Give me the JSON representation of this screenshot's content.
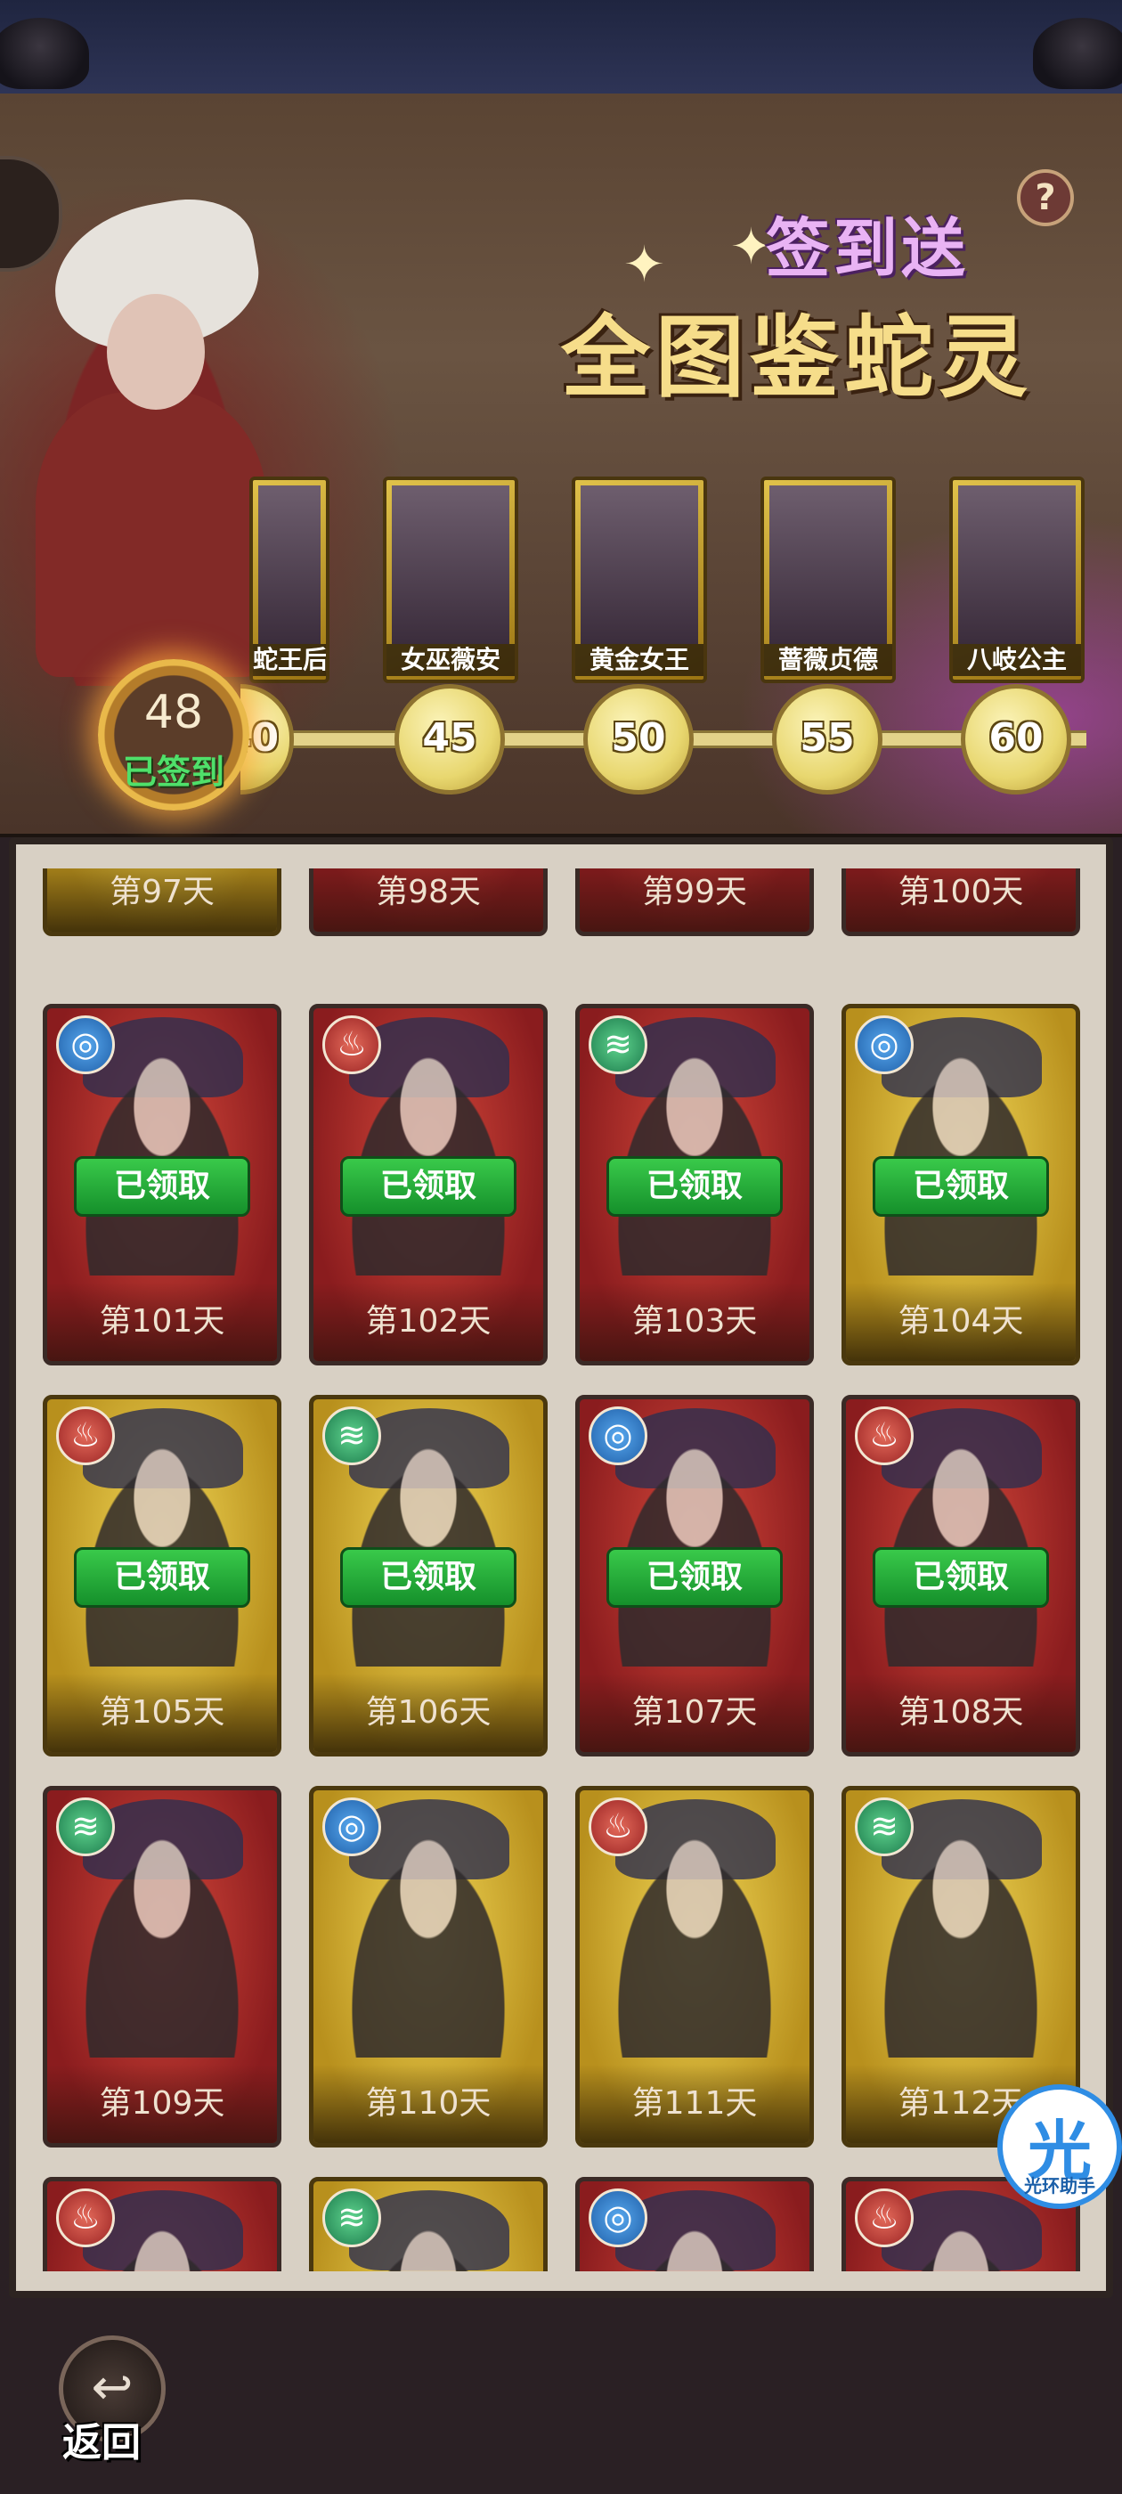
{
  "header": {
    "title_sub": "签到送",
    "title_main": "全图鉴蛇灵",
    "help_icon": "question-icon"
  },
  "checkin": {
    "count": "48",
    "label": "已签到"
  },
  "rewards": [
    {
      "name": "蛇王后",
      "milestone": "40"
    },
    {
      "name": "女巫薇安",
      "milestone": "45"
    },
    {
      "name": "黄金女王",
      "milestone": "50"
    },
    {
      "name": "蔷薇贞德",
      "milestone": "55"
    },
    {
      "name": "八岐公主",
      "milestone": "60"
    }
  ],
  "grid": {
    "claimed_label": "已领取",
    "rows": [
      [
        {
          "day": "第97天",
          "bg": "gold"
        },
        {
          "day": "第98天",
          "bg": "red"
        },
        {
          "day": "第99天",
          "bg": "red"
        },
        {
          "day": "第100天",
          "bg": "red"
        }
      ],
      [
        {
          "day": "第101天",
          "bg": "red",
          "element": "water",
          "claimed": true
        },
        {
          "day": "第102天",
          "bg": "red",
          "element": "fire",
          "claimed": true
        },
        {
          "day": "第103天",
          "bg": "red",
          "element": "wind",
          "claimed": true
        },
        {
          "day": "第104天",
          "bg": "gold",
          "element": "water",
          "claimed": true
        }
      ],
      [
        {
          "day": "第105天",
          "bg": "gold",
          "element": "fire",
          "claimed": true
        },
        {
          "day": "第106天",
          "bg": "gold",
          "element": "wind",
          "claimed": true
        },
        {
          "day": "第107天",
          "bg": "red",
          "element": "water",
          "claimed": true
        },
        {
          "day": "第108天",
          "bg": "red",
          "element": "fire",
          "claimed": true
        }
      ],
      [
        {
          "day": "第109天",
          "bg": "red",
          "element": "wind",
          "claimed": false
        },
        {
          "day": "第110天",
          "bg": "gold",
          "element": "water",
          "claimed": false
        },
        {
          "day": "第111天",
          "bg": "gold",
          "element": "fire",
          "claimed": false
        },
        {
          "day": "第112天",
          "bg": "gold",
          "element": "wind",
          "claimed": false
        }
      ],
      [
        {
          "day": "",
          "bg": "red",
          "element": "fire",
          "claimed": false
        },
        {
          "day": "",
          "bg": "gold",
          "element": "wind",
          "claimed": false
        },
        {
          "day": "",
          "bg": "red",
          "element": "water",
          "claimed": false
        },
        {
          "day": "",
          "bg": "red",
          "element": "fire",
          "claimed": false
        }
      ]
    ]
  },
  "element_icons": {
    "water": "water-swirl-icon",
    "fire": "fire-icon",
    "wind": "wind-tornado-icon"
  },
  "helper": {
    "glyph": "光",
    "label": "光环助手"
  },
  "footer": {
    "back_label": "返回",
    "back_icon": "back-arrow-icon"
  }
}
